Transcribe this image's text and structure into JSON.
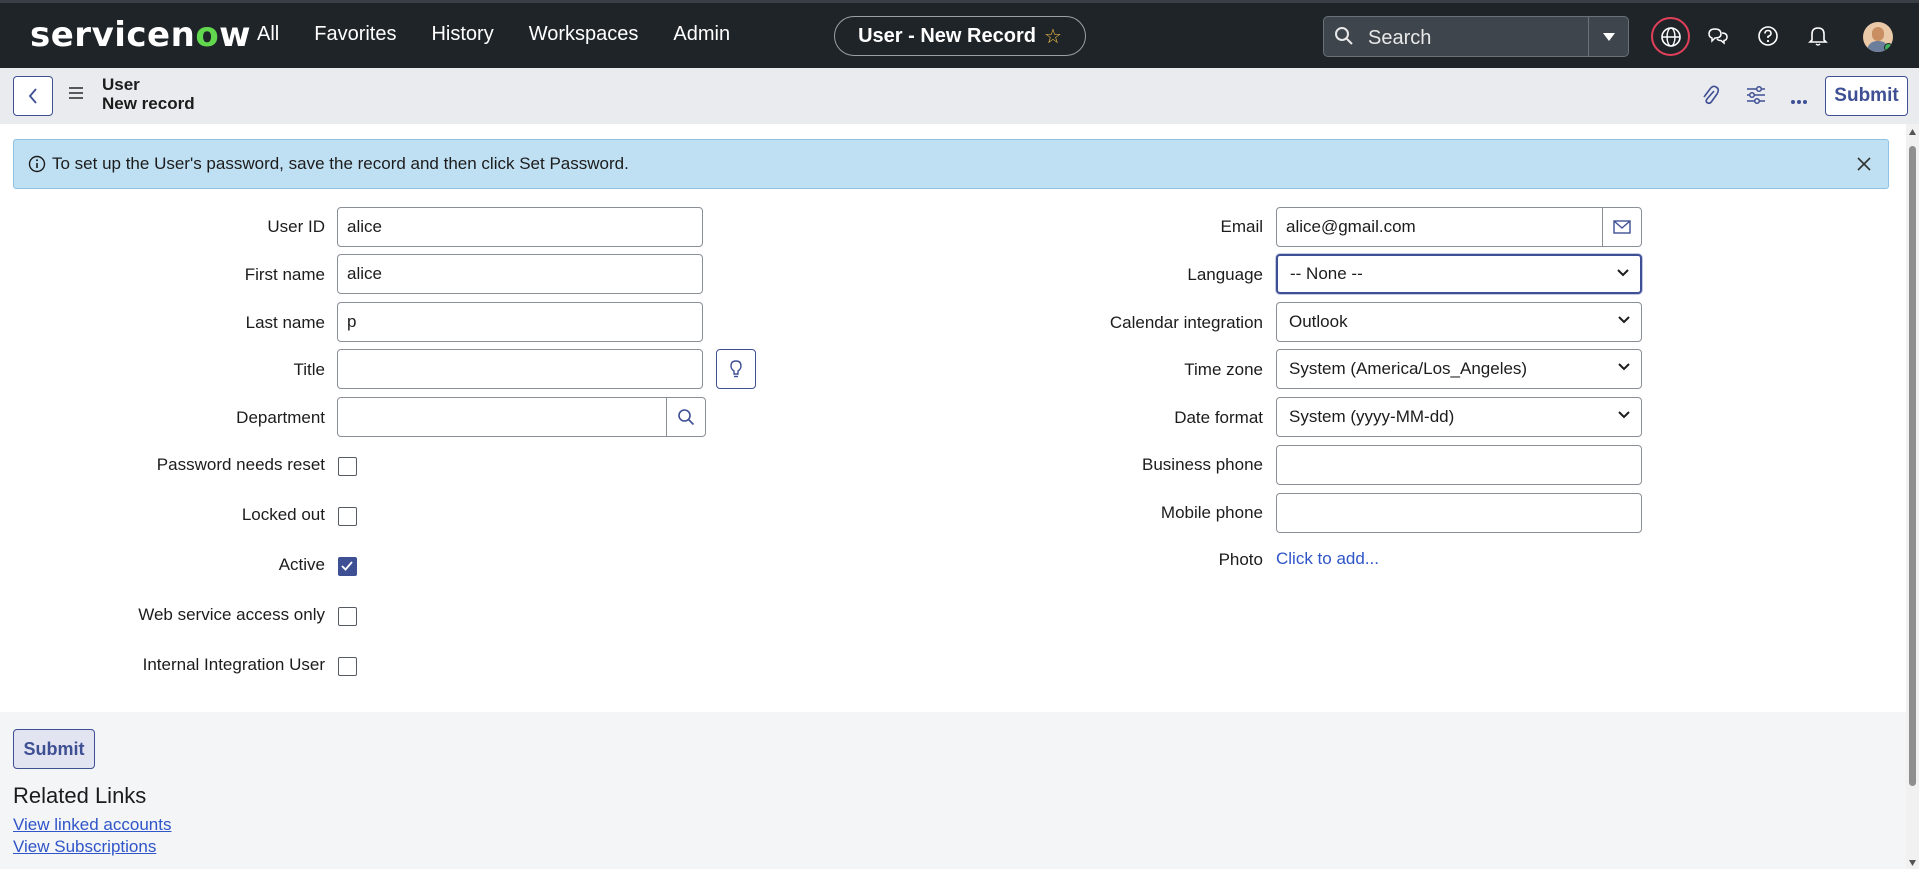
{
  "nav": {
    "logo": "servicenow",
    "links": [
      "All",
      "Favorites",
      "History",
      "Workspaces",
      "Admin"
    ],
    "record_pill": "User - New Record",
    "search_placeholder": "Search"
  },
  "header": {
    "record_type": "User",
    "record_state": "New record",
    "submit": "Submit"
  },
  "banner": {
    "message": "To set up the User's password, save the record and then click Set Password."
  },
  "form": {
    "left": {
      "user_id": {
        "label": "User ID",
        "value": "alice"
      },
      "first_name": {
        "label": "First name",
        "value": "alice"
      },
      "last_name": {
        "label": "Last name",
        "value": "p"
      },
      "title": {
        "label": "Title",
        "value": ""
      },
      "department": {
        "label": "Department",
        "value": ""
      },
      "password_reset": {
        "label": "Password needs reset",
        "checked": false
      },
      "locked_out": {
        "label": "Locked out",
        "checked": false
      },
      "active": {
        "label": "Active",
        "checked": true
      },
      "web_service": {
        "label": "Web service access only",
        "checked": false
      },
      "internal_integration": {
        "label": "Internal Integration User",
        "checked": false
      }
    },
    "right": {
      "email": {
        "label": "Email",
        "value": "alice@gmail.com"
      },
      "language": {
        "label": "Language",
        "value": "-- None --"
      },
      "calendar": {
        "label": "Calendar integration",
        "value": "Outlook"
      },
      "timezone": {
        "label": "Time zone",
        "value": "System (America/Los_Angeles)"
      },
      "date_format": {
        "label": "Date format",
        "value": "System (yyyy-MM-dd)"
      },
      "business_phone": {
        "label": "Business phone",
        "value": ""
      },
      "mobile_phone": {
        "label": "Mobile phone",
        "value": ""
      },
      "photo": {
        "label": "Photo",
        "link": "Click to add..."
      }
    }
  },
  "footer": {
    "submit": "Submit",
    "related_title": "Related Links",
    "links": [
      "View linked accounts",
      "View Subscriptions"
    ]
  },
  "colors": {
    "nav_bg": "#1f2429",
    "accent": "#3e4f94",
    "banner_bg": "#bfdff2",
    "logo_o": "#62d84e"
  }
}
